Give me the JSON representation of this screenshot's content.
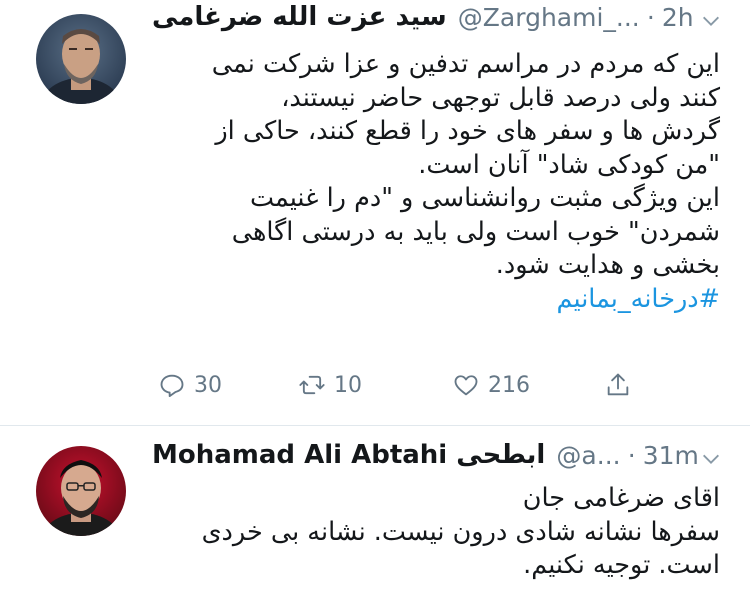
{
  "tweets": [
    {
      "name": "سید عزت الله ضرغامی",
      "handle": "@Zarghami_...",
      "dot": "·",
      "time": "2h",
      "lines": [
        "این که مردم در مراسم تدفین و عزا شرکت نمی",
        "کنند ولی درصد قابل توجهی حاضر نیستند،",
        "گردش ها و سفر های خود را قطع کنند، حاکی از",
        "\"من کودکی شاد\" آنان است.",
        "این ویژگی مثبت روانشناسی و \"دم را غنیمت",
        "شمردن\" خوب است ولی باید به درستی اگاهی",
        "بخشی و هدایت شود."
      ],
      "hashtag": "#درخانه_بمانیم",
      "replies": "30",
      "retweets": "10",
      "likes": "216"
    },
    {
      "name": "Mohamad Ali Abtahi ابطحی",
      "handle": "@a...",
      "dot": "·",
      "time": "31m",
      "lines": [
        "اقای ضرغامی جان",
        "سفرها نشانه شادی درون نیست. نشانه بی خردی",
        "است. توجیه نکنیم."
      ]
    }
  ],
  "colors": {
    "accent": "#1b95e0",
    "muted": "#657786",
    "text": "#14171a",
    "divider": "#e1e8ed"
  },
  "icons": [
    "reply-icon",
    "retweet-icon",
    "like-icon",
    "share-icon",
    "chevron-down-icon"
  ]
}
